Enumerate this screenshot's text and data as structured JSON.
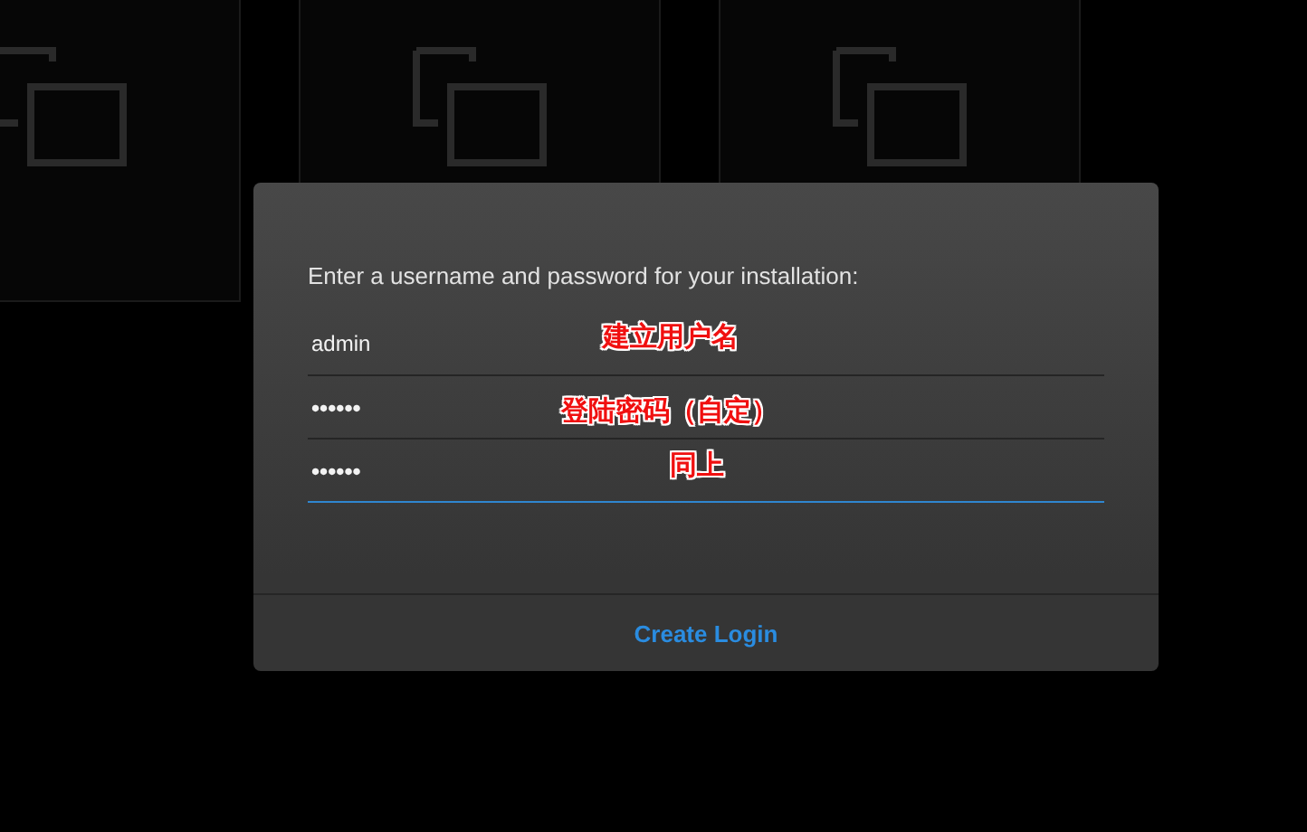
{
  "tiles": [
    {
      "kind": "copy"
    },
    {
      "kind": "copy"
    },
    {
      "kind": "copy"
    }
  ],
  "dialog": {
    "prompt": "Enter a username and password for your installation:",
    "fields": [
      {
        "kind": "text",
        "value": "admin",
        "focused": false,
        "annotation": "建立用户名"
      },
      {
        "kind": "password",
        "value": "••••••",
        "focused": false,
        "annotation": "登陆密码（自定）"
      },
      {
        "kind": "password",
        "value": "••••••",
        "focused": true,
        "annotation": "同上"
      }
    ],
    "button": "Create Login"
  }
}
